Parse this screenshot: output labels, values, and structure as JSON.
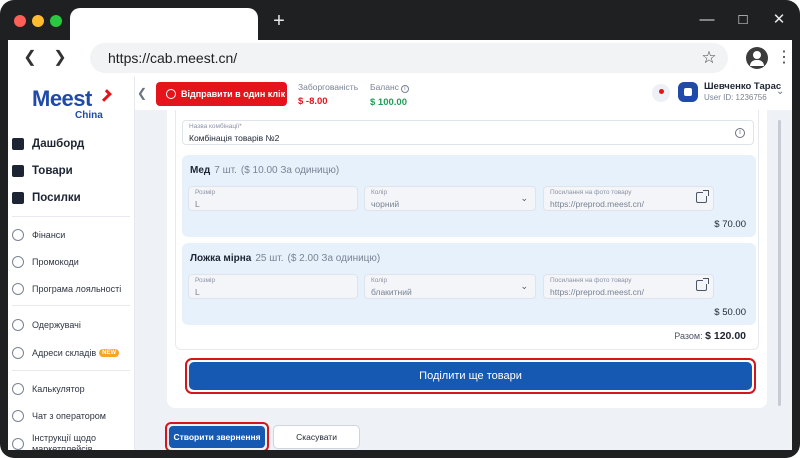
{
  "browser": {
    "url": "https://cab.meest.cn/",
    "colors": {
      "close": "#ff5f57",
      "minimize": "#febc2e",
      "maximize": "#28c840"
    }
  },
  "logo": {
    "main": "Meest",
    "sub": "China"
  },
  "sidebar": {
    "primary": [
      {
        "label": "Дашборд",
        "icon": "dashboard-icon"
      },
      {
        "label": "Товари",
        "icon": "goods-icon"
      },
      {
        "label": "Посилки",
        "icon": "parcels-icon"
      }
    ],
    "group1": [
      {
        "label": "Фінанси",
        "icon": "wallet-icon"
      },
      {
        "label": "Промокоди",
        "icon": "promo-icon"
      },
      {
        "label": "Програма лояльності",
        "icon": "loyalty-icon"
      }
    ],
    "group2": [
      {
        "label": "Одержувачі",
        "icon": "recipients-icon"
      },
      {
        "label": "Адреси складів",
        "icon": "location-icon",
        "badge": "NEW"
      }
    ],
    "group3": [
      {
        "label": "Калькулятор",
        "icon": "calculator-icon"
      },
      {
        "label": "Чат з оператором",
        "icon": "chat-icon"
      },
      {
        "label": "Інструкції щодо маркетплейсів",
        "icon": "instructions-icon"
      }
    ]
  },
  "header": {
    "send_label": "Відправити в один клік",
    "debt_label": "Заборгованість",
    "debt_value": "$ -8.00",
    "balance_label": "Баланс",
    "balance_value": "$ 100.00",
    "user_name": "Шевченко Тарас",
    "user_id": "User ID: 1236756",
    "colors": {
      "accent": "#e3151b",
      "debt": "#e3151b",
      "balance": "#1f9d55",
      "brand": "#1f4aa8"
    }
  },
  "form": {
    "combo_label": "Назва комбінації*",
    "combo_value": "Комбінація товарів №2",
    "items": [
      {
        "name": "Мед",
        "qty": "7 шт.",
        "unit_price": "($ 10.00 За одиницю)",
        "size_label": "Розмір",
        "size_value": "L",
        "color_label": "Колір",
        "color_value": "чорний",
        "link_label": "Посилання на фото товару",
        "link_value": "https://preprod.meest.cn/",
        "price": "$ 70.00"
      },
      {
        "name": "Ложка мірна",
        "qty": "25 шт.",
        "unit_price": "($ 2.00 За одиницю)",
        "size_label": "Розмір",
        "size_value": "L",
        "color_label": "Колір",
        "color_value": "блакитний",
        "link_label": "Посилання на фото товару",
        "link_value": "https://preprod.meest.cn/",
        "price": "$ 50.00"
      }
    ],
    "total_label": "Разом:",
    "total_value": "$ 120.00",
    "share_label": "Поділити ще товари",
    "create_label": "Створити звернення",
    "cancel_label": "Скасувати"
  }
}
